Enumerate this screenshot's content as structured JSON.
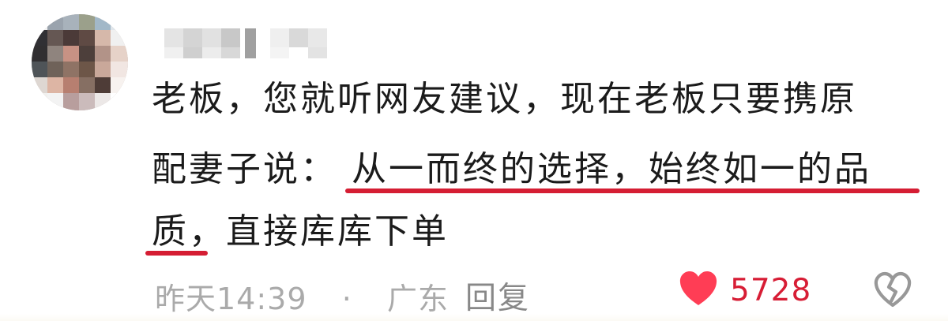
{
  "comment": {
    "text_line_1": "老板，您就听网友建议，现在老板只要携原",
    "text_line_2_before": "配妻子说：",
    "text_line_2_highlight": "从一而终的选择，始终如一的品",
    "text_line_3_highlight": "质",
    "text_line_3_after": "，直接库库下单",
    "time": "昨天14:39",
    "separator": "·",
    "location": "广东",
    "reply_label": "回复",
    "like_count": "5728"
  },
  "icons": {
    "avatar": "pixelated-avatar",
    "username": "pixelated-username",
    "like": "heart-icon",
    "dislike": "broken-heart-icon"
  },
  "colors": {
    "accent": "#d51d33",
    "like": "#ff3d55",
    "text": "#1b1b1b",
    "meta": "#aaaaaa"
  }
}
